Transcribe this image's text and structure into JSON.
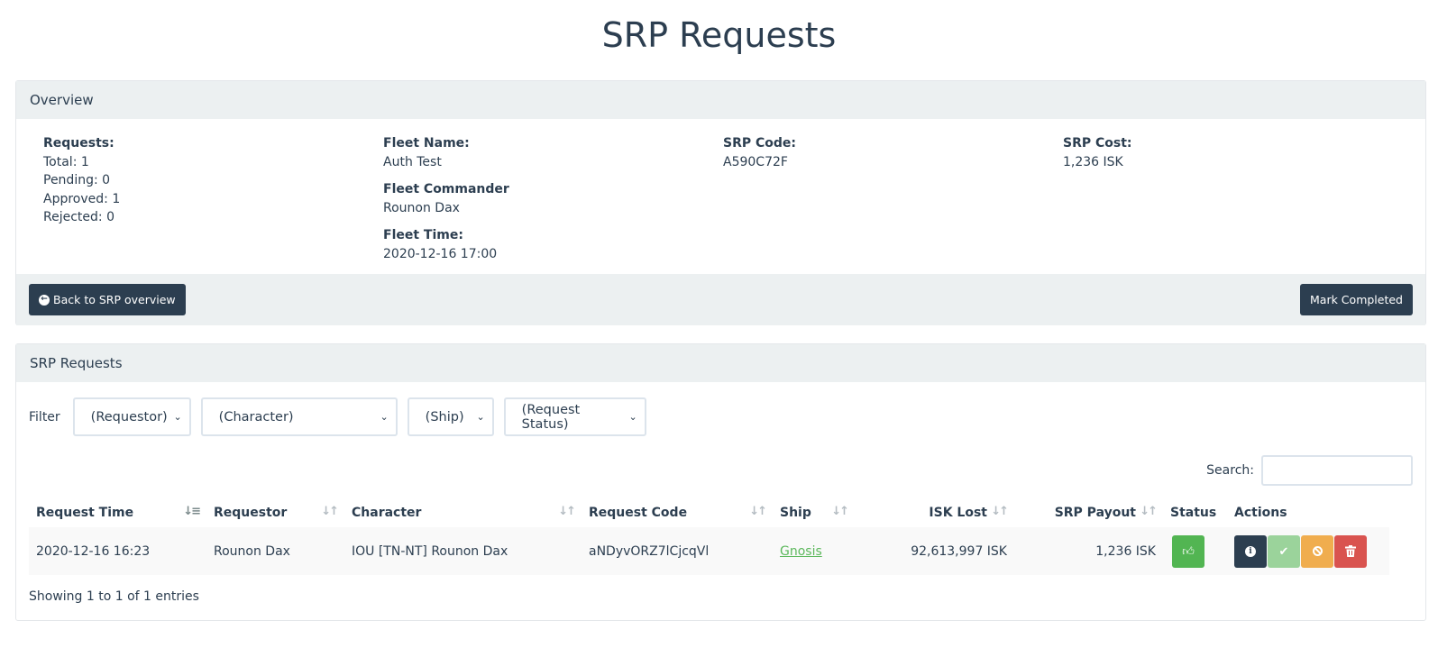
{
  "page": {
    "title": "SRP Requests"
  },
  "overview": {
    "heading": "Overview",
    "requests": {
      "label": "Requests:",
      "total": "Total: 1",
      "pending": "Pending: 0",
      "approved": "Approved: 1",
      "rejected": "Rejected: 0"
    },
    "fleet": {
      "name_label": "Fleet Name:",
      "name": "Auth Test",
      "commander_label": "Fleet Commander",
      "commander": "Rounon Dax",
      "time_label": "Fleet Time:",
      "time": "2020-12-16 17:00"
    },
    "srp_code": {
      "label": "SRP Code:",
      "value": "A590C72F"
    },
    "srp_cost": {
      "label": "SRP Cost:",
      "value": "1,236 ISK"
    },
    "back_button": "Back to SRP overview",
    "complete_button": "Mark Completed"
  },
  "requests": {
    "heading": "SRP Requests",
    "filter_label": "Filter",
    "filters": [
      {
        "name": "requestor",
        "value": "(Requestor)"
      },
      {
        "name": "character",
        "value": "(Character)"
      },
      {
        "name": "ship",
        "value": "(Ship)"
      },
      {
        "name": "status",
        "value": "(Request Status)"
      }
    ],
    "search_label": "Search:",
    "search_value": "",
    "columns": [
      "Request Time",
      "Requestor",
      "Character",
      "Request Code",
      "Ship",
      "ISK Lost",
      "SRP Payout",
      "Status",
      "Actions"
    ],
    "rows": [
      {
        "request_time": "2020-12-16 16:23",
        "requestor": "Rounon Dax",
        "character": "IOU [TN-NT] Rounon Dax",
        "request_code": "aNDyvORZ7lCjcqVl",
        "ship": "Gnosis",
        "isk_lost": "92,613,997 ISK",
        "srp_payout": "1,236 ISK"
      }
    ],
    "footer": "Showing 1 to 1 of 1 entries"
  },
  "colors": {
    "primary": "#2c3e50",
    "success": "#52b552",
    "warning": "#f0ad4e",
    "danger": "#d9534f",
    "panel_bg": "#ecf0f1"
  }
}
